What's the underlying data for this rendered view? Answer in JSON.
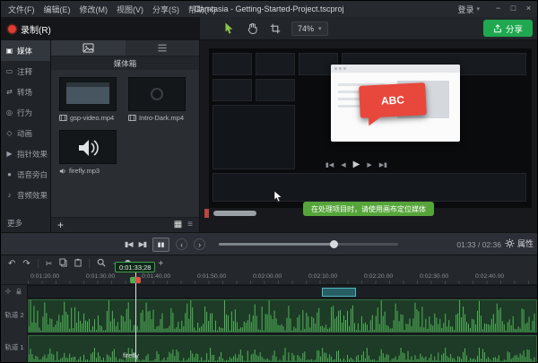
{
  "colors": {
    "accent_green": "#1fa84f",
    "record_red": "#e03c31",
    "callout_red": "#e8473c",
    "waveform_green": "#52b45a",
    "tooltip_green": "#56a53a"
  },
  "icons": {
    "caret_down": "▾",
    "minimize": "−",
    "maximize": "□",
    "close": "×",
    "plus": "+",
    "undo": "↶",
    "redo": "↷",
    "cut": "✂",
    "step_back": "▮◀",
    "step_fwd": "▶▮",
    "pause": "▮▮",
    "prev": "‹",
    "next": "›",
    "stage_jump_start": "▮◀",
    "stage_prev": "◀",
    "stage_play": "▶",
    "stage_next": "▶",
    "stage_jump_end": "▶▮",
    "list_view": "≡",
    "grid_view": "▦"
  },
  "menubar": {
    "menus": [
      "文件(F)",
      "编辑(E)",
      "修改(M)",
      "视图(V)",
      "分享(S)",
      "帮助(H)"
    ],
    "title": "Camtasia - Getting-Started-Project.tscproj",
    "login_label": "登录"
  },
  "toolbar": {
    "record_label": "录制(R)",
    "zoom_value": "74%",
    "share_label": "分享"
  },
  "sidebar": {
    "items": [
      {
        "label": "媒体",
        "icon": "▣"
      },
      {
        "label": "注释",
        "icon": "▭"
      },
      {
        "label": "转场",
        "icon": "⇄"
      },
      {
        "label": "行为",
        "icon": "◎"
      },
      {
        "label": "动画",
        "icon": "◇"
      },
      {
        "label": "指针效果",
        "icon": "▶"
      },
      {
        "label": "语音旁白",
        "icon": "●"
      },
      {
        "label": "音频效果",
        "icon": "♪"
      }
    ],
    "more_label": "更多"
  },
  "media_panel": {
    "bin_title": "媒体箱",
    "items": [
      {
        "name": "gsp-video.mp4",
        "type": "video"
      },
      {
        "name": "Intro-Dark.mp4",
        "type": "video"
      },
      {
        "name": "firefly.mp3",
        "type": "audio"
      }
    ]
  },
  "preview": {
    "callout_text": "ABC",
    "tooltip_text": "在处理项目时，请使用画布定位媒体"
  },
  "playback": {
    "time_display": "01:33 / 02:36",
    "properties_label": "属性"
  },
  "timeline": {
    "playhead_time": "0:01:33;28",
    "ruler_labels": [
      "0:01:20.00",
      "0:01:30.00",
      "0:01:40.00",
      "0:01:50.00",
      "0:02:00.00",
      "0:02:10.00",
      "0:02:20.00",
      "0:02:30.00",
      "0:02:40.00"
    ],
    "tracks": [
      {
        "name": "轨道 2",
        "clip_label": ""
      },
      {
        "name": "轨道 1",
        "clip_label": "firefly"
      }
    ]
  }
}
